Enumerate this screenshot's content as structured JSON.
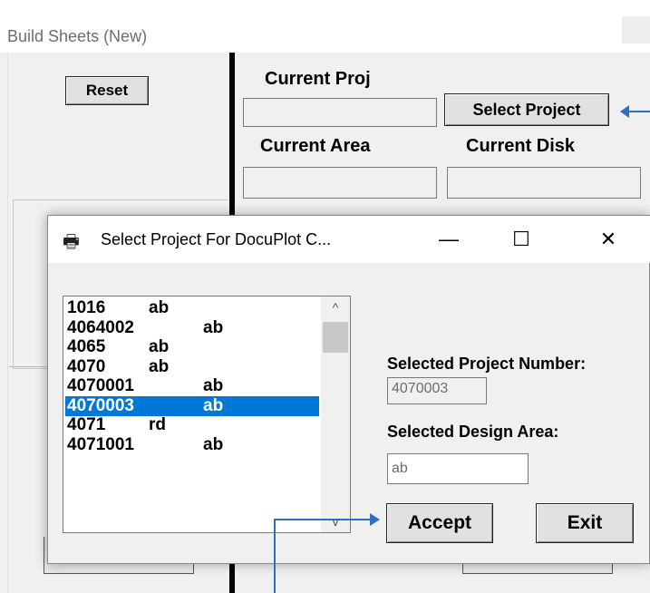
{
  "background_window": {
    "title": "Build Sheets (New)",
    "close_glyph": "×",
    "reset_label": "Reset",
    "current_proj_label": "Current Proj",
    "select_project_label": "Select Project",
    "current_area_label": "Current Area",
    "current_disk_label": "Current Disk",
    "current_proj_value": "",
    "current_area_value": "",
    "current_disk_value": ""
  },
  "dialog": {
    "icon": "printer-icon",
    "icon_glyph": "🖶",
    "title": "Select Project For DocuPlot C...",
    "minimize_glyph": "—",
    "maximize_glyph": "☐",
    "close_glyph": "✕",
    "projects": [
      {
        "number": "1016",
        "area": "ab",
        "selected": false
      },
      {
        "number": "4064002",
        "area": "ab",
        "selected": false
      },
      {
        "number": "4065",
        "area": "ab",
        "selected": false
      },
      {
        "number": "4070",
        "area": "ab",
        "selected": false
      },
      {
        "number": "4070001",
        "area": "ab",
        "selected": false
      },
      {
        "number": "4070003",
        "area": "ab",
        "selected": true
      },
      {
        "number": "4071",
        "area": "rd",
        "selected": false
      },
      {
        "number": "4071001",
        "area": "ab",
        "selected": false
      }
    ],
    "scroll_up_glyph": "^",
    "scroll_down_glyph": "v",
    "selected_project_number_label": "Selected Project Number:",
    "selected_project_number_value": "4070003",
    "selected_design_area_label": "Selected Design Area:",
    "selected_design_area_value": "ab",
    "accept_label": "Accept",
    "exit_label": "Exit"
  },
  "colors": {
    "selection": "#0078d7",
    "arrow": "#2e6fbf",
    "window_bg": "#f0f0f0"
  }
}
